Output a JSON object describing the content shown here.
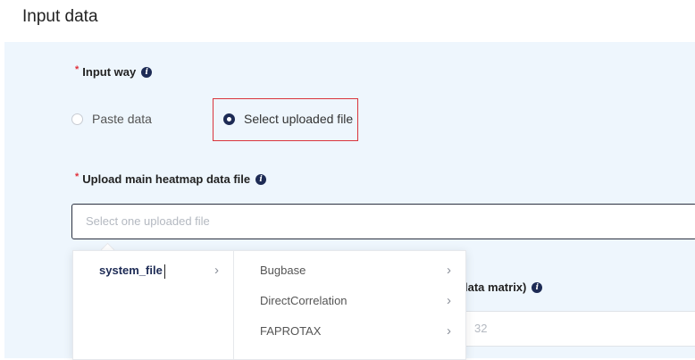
{
  "page": {
    "title": "Input data"
  },
  "input_way": {
    "label": "Input way",
    "options": [
      {
        "label": "Paste data",
        "selected": false
      },
      {
        "label": "Select uploaded file",
        "selected": true
      }
    ]
  },
  "upload_main": {
    "label": "Upload main heatmap data file",
    "placeholder": "Select one uploaded file"
  },
  "cascader": {
    "level1": [
      {
        "label": "system_file",
        "active": true
      }
    ],
    "level2": [
      {
        "label": "Bugbase"
      },
      {
        "label": "DirectCorrelation"
      },
      {
        "label": "FAPROTAX"
      }
    ]
  },
  "next_field": {
    "label_partial": "lata matrix)",
    "value_placeholder": "32"
  },
  "colors": {
    "accent": "#1d2b55",
    "required": "#e0303a",
    "highlight_border": "#d9343c",
    "panel_bg": "#eef6fd"
  }
}
